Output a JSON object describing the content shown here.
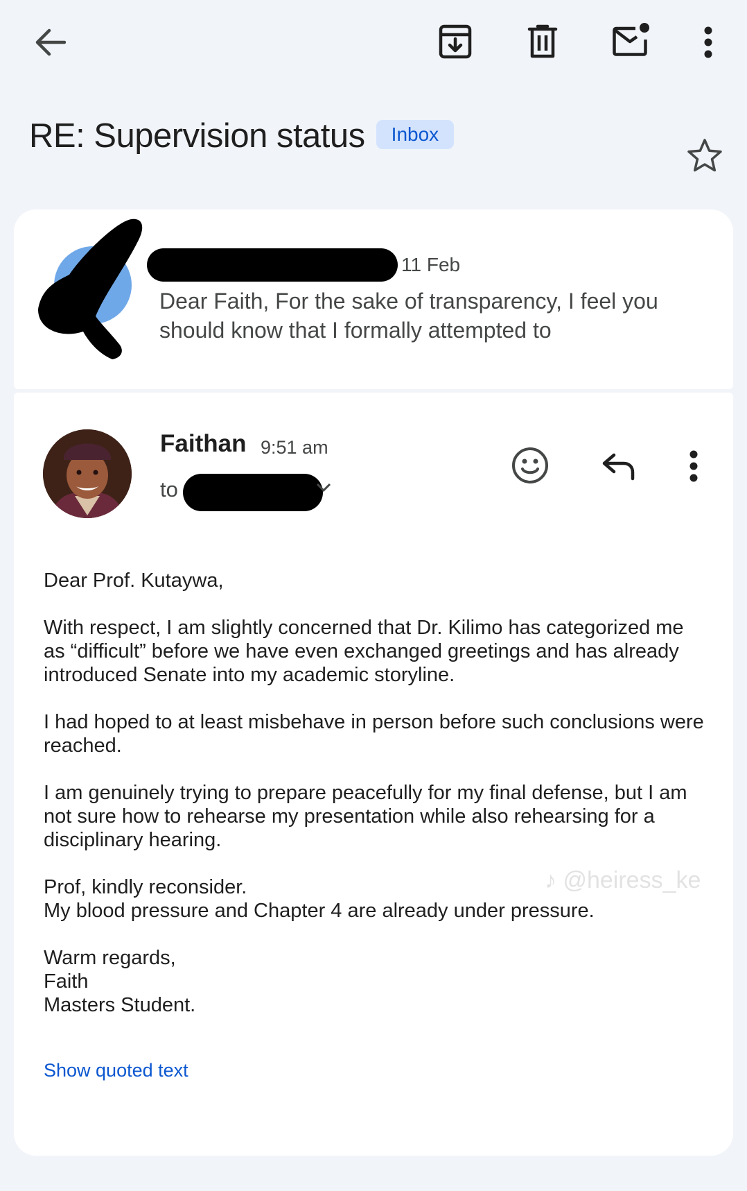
{
  "toolbar": {
    "back_icon": "arrow-back-icon",
    "archive_icon": "archive-icon",
    "delete_icon": "delete-icon",
    "mark_unread_icon": "mark-unread-icon",
    "more_icon": "more-vert-icon"
  },
  "thread": {
    "subject": "RE: Supervision status",
    "label": "Inbox",
    "star_icon": "star-outline-icon"
  },
  "collapsed_message": {
    "date": "11 Feb",
    "snippet": "Dear Faith, For the sake of transparency, I feel you should know that I formally attempted to"
  },
  "open_message": {
    "sender": "Faithan",
    "time": "9:51 am",
    "to_label": "to",
    "actions": {
      "react_icon": "emoji-smile-icon",
      "reply_icon": "reply-icon",
      "more_icon": "more-vert-icon"
    },
    "paragraphs": [
      "Dear Prof. Kutaywa,",
      "With respect, I am slightly concerned that Dr. Kilimo has categorized me as “difficult” before we have even exchanged greetings and has already introduced Senate into my academic storyline.",
      "I had hoped to at least misbehave in person before such conclusions were reached.",
      "I am genuinely trying to prepare peacefully for my final defense, but I am not sure how to rehearse my presentation while also rehearsing for a disciplinary hearing.",
      "Prof, kindly reconsider.\nMy blood pressure and Chapter 4 are already under pressure.",
      "Warm regards,\nFaith\nMasters Student."
    ],
    "show_quoted": "Show quoted text"
  },
  "watermark": "@heiress_ke",
  "colors": {
    "background": "#f1f4f9",
    "card": "#ffffff",
    "accent": "#0b57d0",
    "chip": "#d3e3fd"
  }
}
